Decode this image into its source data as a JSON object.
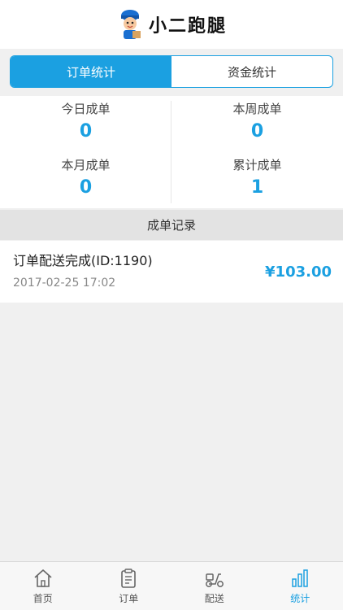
{
  "header": {
    "logo_text": "小二跑腿"
  },
  "segment": {
    "tabs": [
      {
        "label": "订单统计",
        "active": true
      },
      {
        "label": "资金统计",
        "active": false
      }
    ]
  },
  "stats": [
    {
      "label": "今日成单",
      "value": "0"
    },
    {
      "label": "本周成单",
      "value": "0"
    },
    {
      "label": "本月成单",
      "value": "0"
    },
    {
      "label": "累计成单",
      "value": "1"
    }
  ],
  "records_title": "成单记录",
  "records": [
    {
      "title": "订单配送完成(ID:1190)",
      "time": "2017-02-25 17:02",
      "amount": "¥103.00"
    }
  ],
  "tabbar": [
    {
      "label": "首页",
      "icon": "home-icon"
    },
    {
      "label": "订单",
      "icon": "clipboard-icon"
    },
    {
      "label": "配送",
      "icon": "scooter-icon"
    },
    {
      "label": "统计",
      "icon": "bar-chart-icon",
      "active": true
    }
  ],
  "colors": {
    "accent": "#1ba0e1",
    "background": "#f0f0f0"
  }
}
